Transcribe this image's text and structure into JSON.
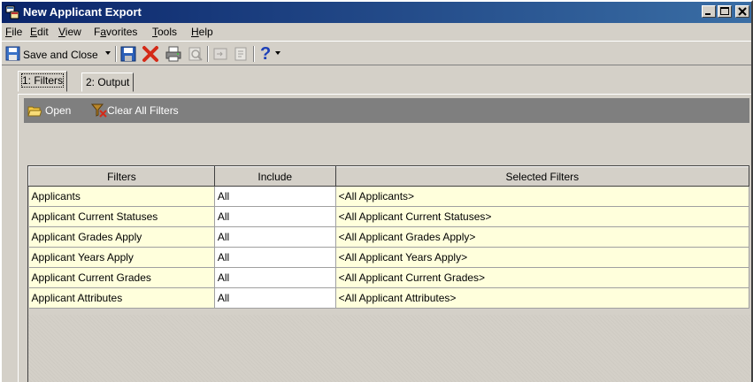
{
  "window": {
    "title": "New Applicant Export",
    "controls": [
      "minimize-icon",
      "maximize-icon",
      "close-icon"
    ]
  },
  "menu": {
    "items": [
      {
        "label": "File",
        "mnemonic": "F"
      },
      {
        "label": "Edit",
        "mnemonic": "E"
      },
      {
        "label": "View",
        "mnemonic": "V"
      },
      {
        "label": "Favorites",
        "mnemonic": "a"
      },
      {
        "label": "Tools",
        "mnemonic": "T"
      },
      {
        "label": "Help",
        "mnemonic": "H"
      }
    ]
  },
  "toolbar": {
    "save_close_label": "Save and Close",
    "icons": [
      "save-close-icon",
      "dropdown-arrow-icon",
      "save-icon",
      "delete-icon",
      "print-icon",
      "print-preview-icon",
      "export-icon",
      "properties-icon",
      "help-icon",
      "dropdown-arrow-icon"
    ]
  },
  "tabs": [
    {
      "label": "1: Filters",
      "active": true
    },
    {
      "label": "2: Output",
      "active": false
    }
  ],
  "filter_toolbar": {
    "open_label": "Open",
    "clear_label": "Clear All Filters"
  },
  "grid": {
    "columns": [
      "Filters",
      "Include",
      "Selected Filters"
    ],
    "rows": [
      {
        "filter": "Applicants",
        "include": "All",
        "selected": "<All Applicants>"
      },
      {
        "filter": "Applicant Current Statuses",
        "include": "All",
        "selected": "<All Applicant Current Statuses>"
      },
      {
        "filter": "Applicant Grades Apply",
        "include": "All",
        "selected": "<All Applicant Grades Apply>"
      },
      {
        "filter": "Applicant Years Apply",
        "include": "All",
        "selected": "<All Applicant Years Apply>"
      },
      {
        "filter": "Applicant Current Grades",
        "include": "All",
        "selected": "<All Applicant Current Grades>"
      },
      {
        "filter": "Applicant Attributes",
        "include": "All",
        "selected": "<All Applicant Attributes>"
      }
    ]
  },
  "colors": {
    "title_bar_start": "#0a246a",
    "title_bar_end": "#3a6ea5",
    "chrome": "#d4d0c8",
    "filter_cell_bg": "#ffffdc",
    "strip_bg": "#7f7f7f"
  }
}
